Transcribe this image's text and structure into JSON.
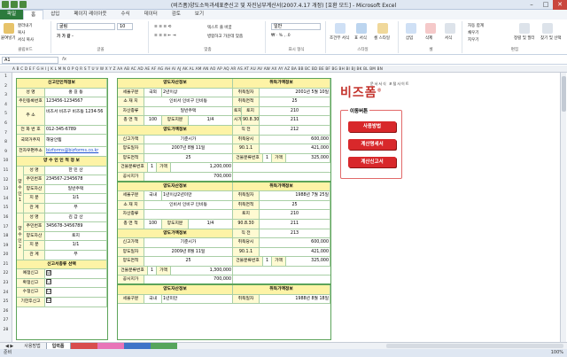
{
  "window": {
    "title": "(비즈폼)양도소득과세표준신고 및 자진납부계산서(2007.4.17 개정) [호환 모드] - Microsoft Excel"
  },
  "ribbon_tabs": [
    "파일",
    "홈",
    "삽입",
    "페이지 레이아웃",
    "수식",
    "데이터",
    "검토",
    "보기"
  ],
  "ribbon": {
    "paste": "붙여넣기",
    "cut": "잘라내기",
    "copy": "복사",
    "format_painter": "서식 복사",
    "clipboard": "클립보드",
    "font_name": "굴림",
    "font_size": "10",
    "font": "글꼴",
    "wrap": "텍스트 줄 바꿈",
    "merge": "병합하고 가운데 맞춤",
    "align": "맞춤",
    "number_format": "일반",
    "number": "표시 형식",
    "cond_format": "조건부 서식",
    "table_format": "표 서식",
    "cell_style": "셀 스타일",
    "style": "스타일",
    "insert": "삽입",
    "delete": "삭제",
    "format": "서식",
    "cells": "셀",
    "autosum": "자동 합계",
    "fill": "채우기",
    "clear": "지우기",
    "sort": "정렬 및 필터",
    "find": "찾기 및 선택",
    "edit": "편집"
  },
  "formula": {
    "namebox": "A1",
    "fx": "fx"
  },
  "col_header": "A B C D E F G H I J K L M N O P Q R S T U V W X Y Z AA AB AC AD AE AF AG AH AI AJ AK AL AM AN AO AP AQ AR AS AT AU AV AW AX AY AZ BA BB BC BD BE BF BG BH BI BJ BK BL BM BN",
  "rows": [
    "1",
    "2",
    "3",
    "4",
    "5",
    "6",
    "7",
    "8",
    "9",
    "10",
    "11",
    "12",
    "13",
    "14",
    "15",
    "16",
    "17",
    "18",
    "19",
    "20",
    "21",
    "22",
    "23",
    "24",
    "25",
    "26",
    "27",
    "28"
  ],
  "left_pane": {
    "applicant_title": "신고인인적정보",
    "name_label": "성   명",
    "name_value": "홍 길 동",
    "rrn_label": "주민등록번호",
    "rrn_value": "123456-1234567",
    "addr_label": "주   소",
    "addr_value": "비즈서 비즈구 비즈동 1234-56",
    "phone_label": "전 화 번 호",
    "phone_value": "012-345-6789",
    "residence_label": "국외거주지",
    "residence_value": "해당안됨",
    "email_label": "전자우편주소",
    "email_value": "bizforms@bizforms.co.kr",
    "transferee_title": "양 수 인 인 적 정 보",
    "transferee1_name_label": "성   명",
    "transferee1_name": "한 민 산",
    "transferee1_rrn_label": "주민번호",
    "transferee1_rrn": "234567-2345678",
    "transferee1_asset_label": "양도자산",
    "transferee1_asset": "일반주택",
    "transferee1_share_label": "지   분",
    "transferee1_share": "1/1",
    "transferee1_rel_label": "관   계",
    "transferee1_rel": "무",
    "transferee_side1": "양수인1",
    "transferee2_name_label": "성   명",
    "transferee2_name": "김 갑 산",
    "transferee2_rrn_label": "주민번호",
    "transferee2_rrn": "345678-3456789",
    "transferee2_asset_label": "양도자산",
    "transferee2_asset": "토지",
    "transferee2_share_label": "지   분",
    "transferee2_share": "1/1",
    "transferee2_rel_label": "관   계",
    "transferee2_rel": "무",
    "transferee_side2": "양수인2",
    "report_type_title": "신고서종류 선택",
    "report_types": [
      "예정신고",
      "확정신고",
      "수정신고",
      "기한후신고"
    ],
    "report_checks": [
      "☑",
      "☐",
      "☐",
      "☐"
    ]
  },
  "center_pane": {
    "asset1_title": "양도자산정보",
    "asset1_rate_title": "취득가액정보",
    "type_label": "세율구분",
    "type_domestic": "국외",
    "type_period": "2년이상",
    "acq_date_label": "취득일자",
    "acq_date": "2001년 5월 10일",
    "location_label": "소 재 지",
    "location": "인비서 인비구 인비동",
    "acq_area_label": "취득면적",
    "acq_area": "25",
    "asset_type_label": "자산종류",
    "asset_type": "일반주택",
    "gov_label": "토지",
    "gov_value": "210",
    "total_area_label": "총 면 적",
    "total_area": "100",
    "transfer_share_label": "양도지분",
    "transfer_share": "1/4",
    "unit_price_label": "90.8.30",
    "unit_price": "211",
    "transfer_price_title": "양도가액정보",
    "std_label": "직  전",
    "std_value": "212",
    "report_price_label": "신고가액",
    "report_price": "기준시가",
    "acq_price_label": "취득당시",
    "acq_price": "600,000",
    "transfer_date_label": "양도일자",
    "transfer_date": "2007년 8월 11일",
    "col_901": "90.1.1",
    "col_901_val": "421,000",
    "transfer_area_label": "양도면적",
    "transfer_area": "25",
    "building_label": "건물분류번호",
    "building_code": "1",
    "building_price_label": "가액",
    "building_price": "325,000",
    "bldg_num_label": "건물분류번호",
    "bldg_num": "1",
    "bldg_price_label": "가액",
    "bldg_price": "1,200,000",
    "public_price_label": "공시지가",
    "public_price": "700,000",
    "asset2_title": "양도자산정보",
    "asset2_rate_title": "취득가액정보",
    "type2_domestic": "국내",
    "type2_period": "1년이상2년미만",
    "acq_date2": "1988년 7월 25일",
    "location2": "인비서 인비구 인비동",
    "acq_area2": "25",
    "gov2_value": "210",
    "total_area2": "100",
    "transfer_share2": "1/4",
    "unit_price2": "211",
    "std2_value": "213",
    "acq_price2": "600,000",
    "transfer_date2": "2009년 8월 11일",
    "col_901_val2": "421,000",
    "transfer_area2": "25",
    "building_price2": "325,000",
    "bldg_price2": "1,300,000",
    "public_price2": "700,000",
    "asset3_title": "양도자산정보",
    "asset3_rate_title": "취득가액정보",
    "type3_domestic": "국내",
    "type3_period": "1년미만",
    "acq_date3": "1988년 8월 18일",
    "land_label": "토지",
    "price_label": "시가"
  },
  "sidebar": {
    "logo": "비즈폼",
    "logo_sub": "문서서식 포털사이트",
    "nav_title": "이동버튼",
    "nav_buttons": [
      "사용방법",
      "계산명세서",
      "계산신고서"
    ]
  },
  "sheet_tabs": [
    "사용방법",
    "입력폼",
    "",
    "",
    "",
    ""
  ],
  "status": {
    "left": "준비",
    "zoom": "100%"
  }
}
